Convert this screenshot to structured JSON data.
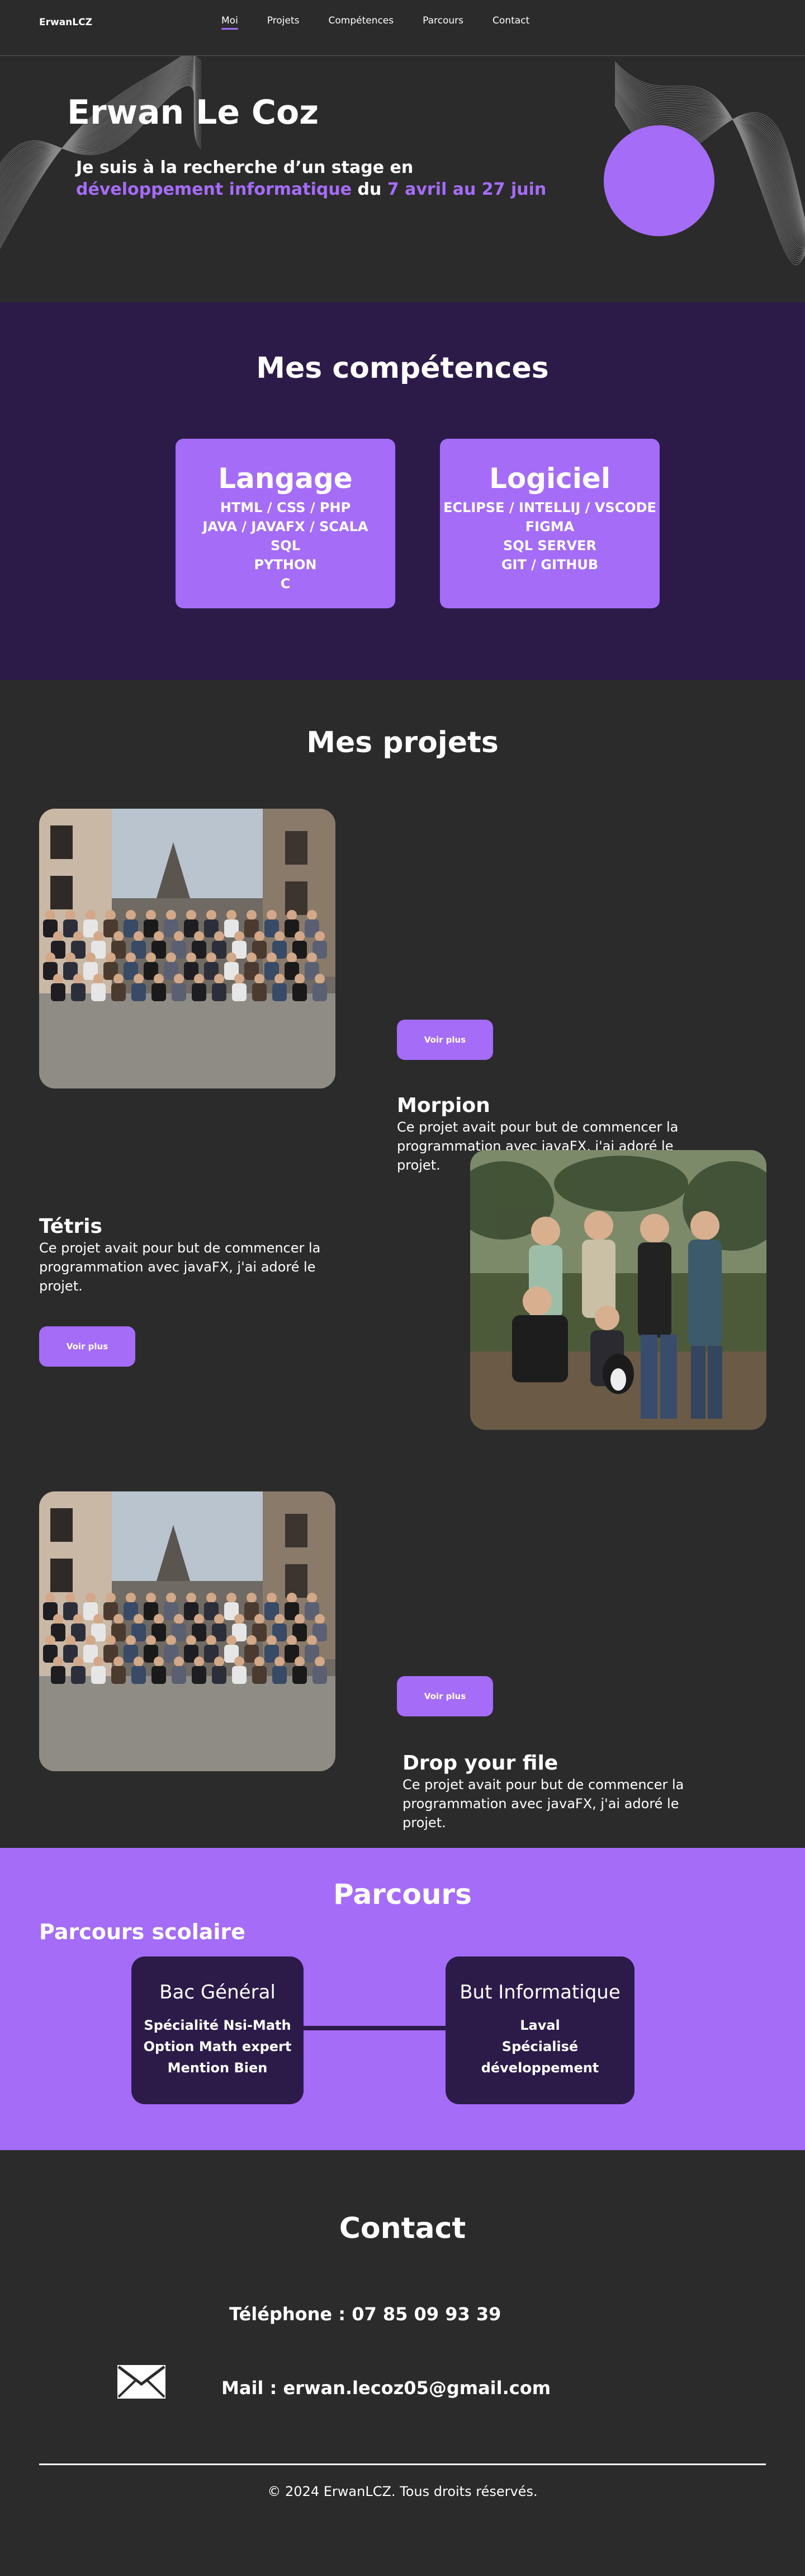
{
  "nav": {
    "brand": "ErwanLCZ",
    "links": [
      "Moi",
      "Projets",
      "Compétences",
      "Parcours",
      "Contact"
    ]
  },
  "hero": {
    "name": "Erwan Le Coz",
    "line1": "Je suis à la recherche d’un stage en",
    "line2_highlight": "développement informatique",
    "line2_mid": " du ",
    "line2_date": "7 avril au 27 juin"
  },
  "skills": {
    "title": "Mes compétences",
    "cards": [
      {
        "title": "Langage",
        "items": [
          "HTML / CSS / PHP",
          "JAVA / JAVAFX / SCALA",
          "SQL",
          "PYTHON",
          "C"
        ]
      },
      {
        "title": "Logiciel",
        "items": [
          "ECLIPSE / INTELLIJ / VSCODE",
          "FIGMA",
          "SQL SERVER",
          "GIT / GITHUB"
        ]
      }
    ]
  },
  "projects": {
    "title": "Mes projets",
    "items": [
      {
        "title": "Morpion",
        "desc": "Ce projet avait pour but de commencer la programmation avec javaFX, j'ai adoré le projet.",
        "button": "Voir plus"
      },
      {
        "title": "Tétris",
        "desc": "Ce projet avait pour but de commencer la programmation avec javaFX, j'ai adoré le projet.",
        "button": "Voir plus"
      },
      {
        "title": "Drop your file",
        "desc": "Ce projet avait pour but de commencer la programmation avec javaFX, j'ai adoré le projet.",
        "button": "Voir plus"
      }
    ]
  },
  "parcours": {
    "title": "Parcours",
    "subtitle": "Parcours scolaire",
    "cards": [
      {
        "title": "Bac Général",
        "lines": [
          "Spécialité Nsi-Math",
          "Option Math expert",
          "Mention Bien"
        ]
      },
      {
        "title": "But Informatique",
        "lines": [
          "Laval",
          "Spécialisé développement"
        ]
      }
    ]
  },
  "contact": {
    "title": "Contact",
    "phone": "Téléphone : 07 85 09 93 39",
    "mail": "Mail : erwan.lecoz05@gmail.com",
    "footer": "© 2024 ErwanLCZ. Tous droits réservés."
  },
  "colors": {
    "accent": "#a56cf7",
    "dark_purple": "#2c1b49",
    "background": "#2b2b2b"
  }
}
